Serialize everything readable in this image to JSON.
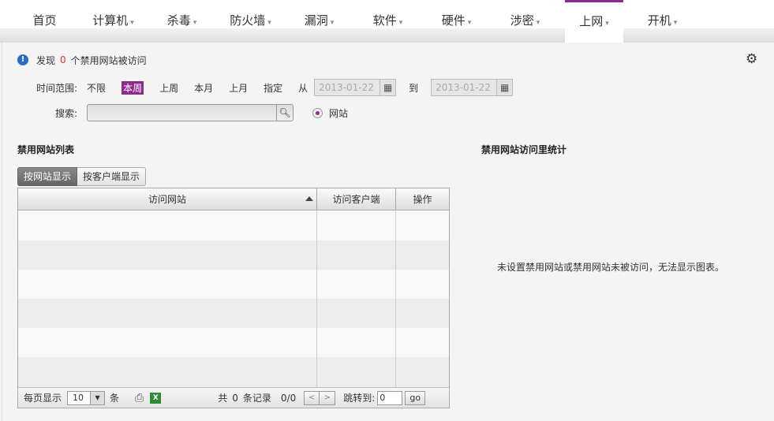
{
  "nav": {
    "items": [
      {
        "label": "首页",
        "dropdown": false
      },
      {
        "label": "计算机",
        "dropdown": true
      },
      {
        "label": "杀毒",
        "dropdown": true
      },
      {
        "label": "防火墙",
        "dropdown": true
      },
      {
        "label": "漏洞",
        "dropdown": true
      },
      {
        "label": "软件",
        "dropdown": true
      },
      {
        "label": "硬件",
        "dropdown": true
      },
      {
        "label": "涉密",
        "dropdown": true
      },
      {
        "label": "上网",
        "dropdown": true,
        "active": true
      },
      {
        "label": "开机",
        "dropdown": true
      }
    ],
    "caret": "▾"
  },
  "info": {
    "prefix": "发现",
    "count": "0",
    "suffix": "个禁用网站被访问"
  },
  "filter": {
    "time_label": "时间范围:",
    "range_options": [
      "不限",
      "本周",
      "上周",
      "本月",
      "上月",
      "指定"
    ],
    "selected_range": "本周",
    "from_label": "从",
    "to_label": "到",
    "from_date": "2013-01-22",
    "to_date": "2013-01-22",
    "search_label": "搜索:",
    "search_value": "",
    "radio_label": "网站"
  },
  "list": {
    "title": "禁用网站列表",
    "tabs": [
      "按网站显示",
      "按客户端显示"
    ],
    "columns": [
      "访问网站",
      "访问客户端",
      "操作"
    ],
    "rows": []
  },
  "pager": {
    "per_page_label": "每页显示",
    "per_page_value": "10",
    "per_page_unit": "条",
    "total_prefix": "共",
    "total": "0",
    "total_suffix": "条记录",
    "page_info": "0/0",
    "jump_label": "跳转到:",
    "jump_value": "0",
    "go_label": "go"
  },
  "stats": {
    "title": "禁用网站访问里统计",
    "empty_message": "未设置禁用网站或禁用网站未被访问，无法显示图表。"
  },
  "colors": {
    "accent": "#8e2a8e",
    "count_red": "#dd3333",
    "info_blue": "#2a6ec9"
  }
}
